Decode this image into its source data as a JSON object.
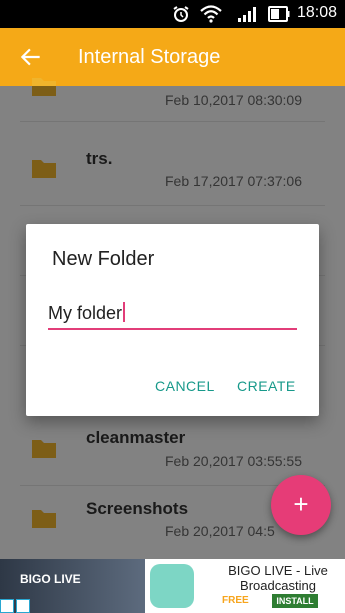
{
  "status_bar": {
    "time": "18:08",
    "icons": [
      "alarm-icon",
      "wifi-icon",
      "signal-icon",
      "battery-icon"
    ]
  },
  "app_bar": {
    "title": "Internal Storage",
    "back_icon": "arrow-back-icon",
    "color": "#f5a917"
  },
  "file_list": [
    {
      "name": "",
      "date": "Feb 10,2017 08:30:09"
    },
    {
      "name": "trs.",
      "date": "Feb 17,2017 07:37:06"
    },
    {
      "name": "",
      "date": ""
    },
    {
      "name": "",
      "date": ""
    },
    {
      "name": "cleanmaster",
      "date": "Feb 20,2017 03:55:55"
    },
    {
      "name": "Screenshots",
      "date": "Feb 20,2017 04:5"
    }
  ],
  "dialog": {
    "title": "New Folder",
    "input_value": "My folder",
    "cancel_label": "CANCEL",
    "create_label": "CREATE",
    "accent_color": "#e23d79",
    "button_color": "#17998a"
  },
  "fab": {
    "icon": "plus-icon",
    "color": "#e63c77"
  },
  "ad": {
    "brand_text": "BIGO LIVE",
    "title": "BIGO LIVE - Live Broadcasting",
    "free_label": "FREE",
    "install_label": "INSTALL"
  }
}
